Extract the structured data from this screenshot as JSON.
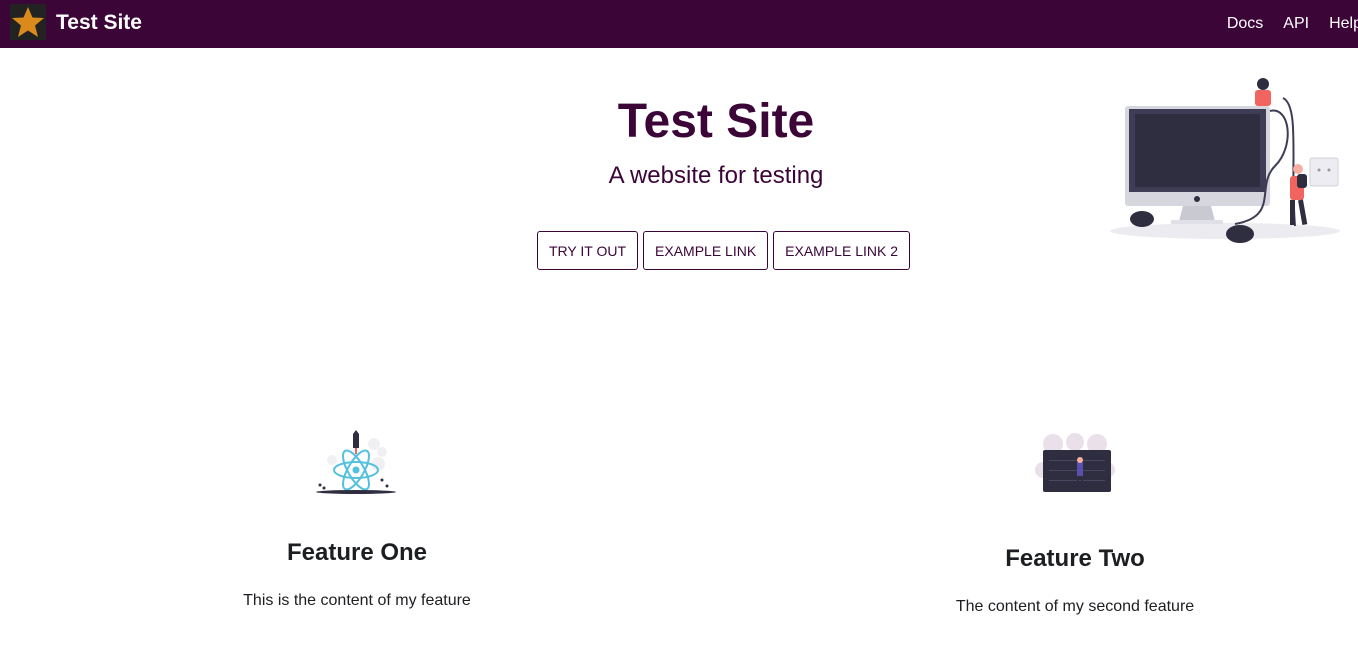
{
  "navbar": {
    "title": "Test Site",
    "links": [
      "Docs",
      "API",
      "Help"
    ]
  },
  "hero": {
    "title": "Test Site",
    "subtitle": "A website for testing",
    "buttons": [
      "TRY IT OUT",
      "EXAMPLE LINK",
      "EXAMPLE LINK 2"
    ]
  },
  "features": [
    {
      "title": "Feature One",
      "content": "This is the content of my feature"
    },
    {
      "title": "Feature Two",
      "content": "The content of my second feature"
    }
  ],
  "colors": {
    "primary": "#3b0538",
    "logo_star": "#d98a1a",
    "illustration_accent": "#f2645f",
    "react_blue": "#53c1de"
  }
}
